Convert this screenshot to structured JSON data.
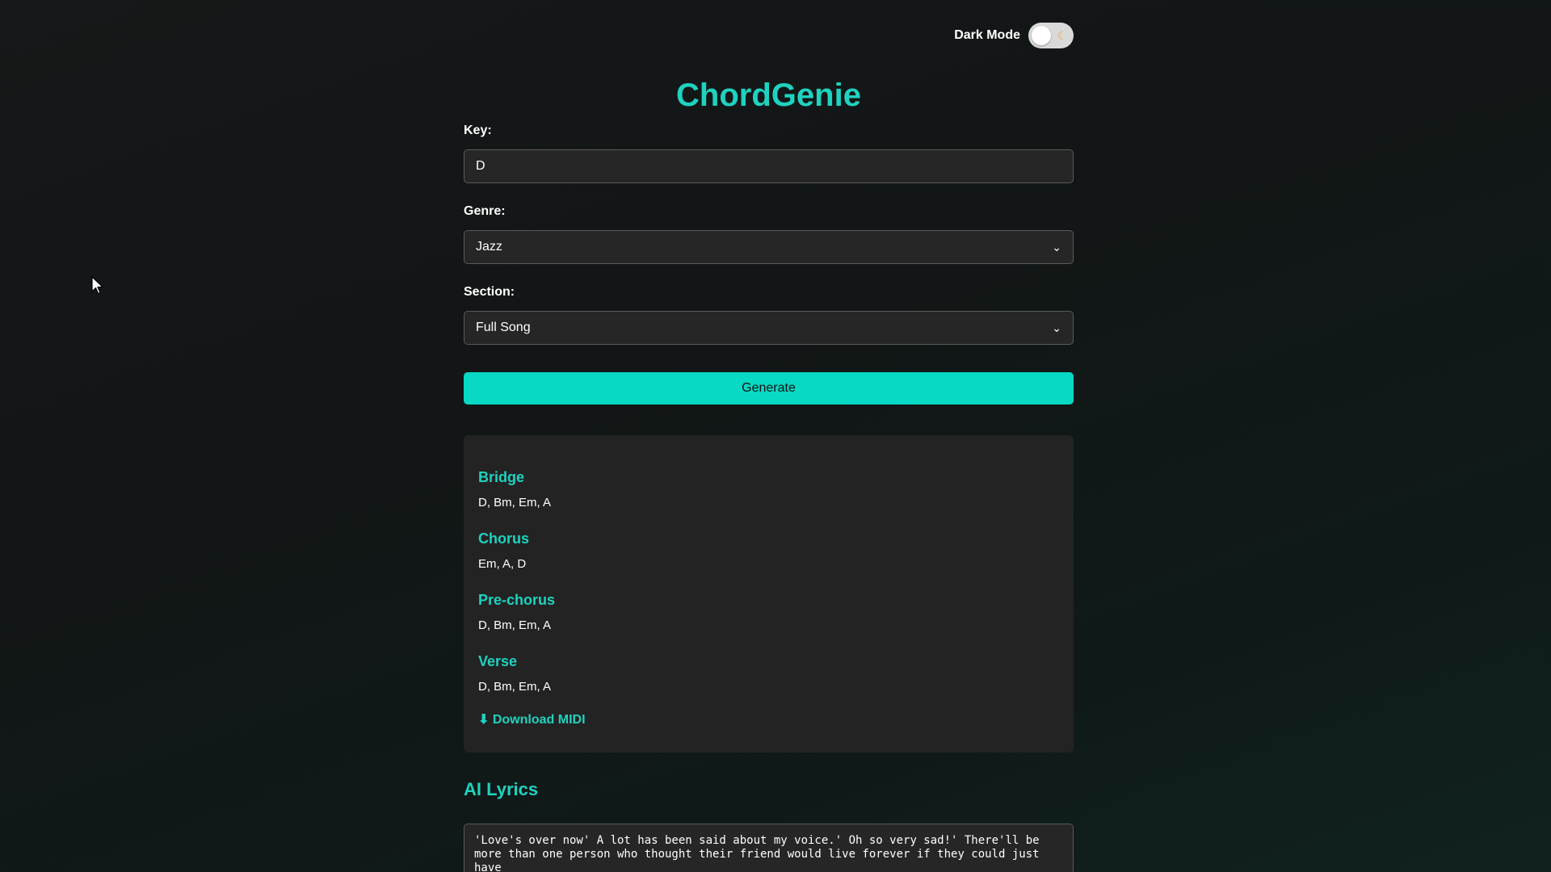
{
  "header": {
    "dark_mode_label": "Dark Mode",
    "toggle_icon": "moon-icon"
  },
  "app": {
    "title": "ChordGenie"
  },
  "form": {
    "key_label": "Key:",
    "key_value": "D",
    "genre_label": "Genre:",
    "genre_value": "Jazz",
    "section_label": "Section:",
    "section_value": "Full Song",
    "generate_label": "Generate"
  },
  "results": {
    "sections": [
      {
        "name": "Bridge",
        "chords": "D, Bm, Em, A"
      },
      {
        "name": "Chorus",
        "chords": "Em, A, D"
      },
      {
        "name": "Pre-chorus",
        "chords": "D, Bm, Em, A"
      },
      {
        "name": "Verse",
        "chords": "D, Bm, Em, A"
      }
    ],
    "download_label": "⬇ Download MIDI"
  },
  "lyrics": {
    "heading": "AI Lyrics",
    "text": "'Love's over now' A lot has been said about my voice.' Oh so very sad!' There'll be more than one person who thought their friend would live forever if they could just have"
  },
  "colors": {
    "accent": "#1ed3bf",
    "button": "#07d9c4",
    "card": "#232323",
    "background": "#141717"
  }
}
